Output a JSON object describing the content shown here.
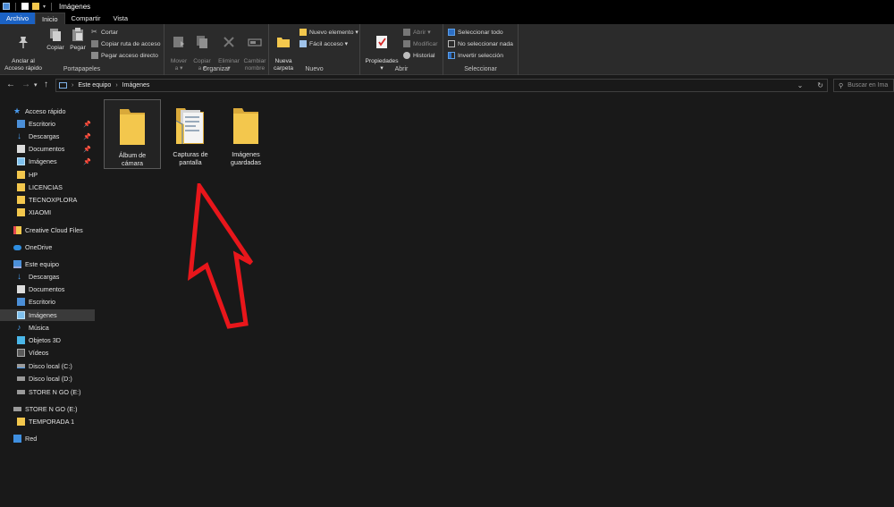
{
  "titlebar": {
    "title": "Imágenes"
  },
  "tabs": [
    {
      "label": "Archivo"
    },
    {
      "label": "Inicio"
    },
    {
      "label": "Compartir"
    },
    {
      "label": "Vista"
    }
  ],
  "ribbon": {
    "portapapeles": {
      "anclar": "Anclar al\nAcceso rápido",
      "copiar": "Copiar",
      "pegar": "Pegar",
      "cortar": "Cortar",
      "copiar_ruta": "Copiar ruta de acceso",
      "pegar_acceso": "Pegar acceso directo",
      "label": "Portapapeles"
    },
    "organizar": {
      "mover": "Mover\na ▾",
      "copiar_a": "Copiar\na ▾",
      "eliminar": "Eliminar\n▾",
      "cambiar_nombre": "Cambiar\nnombre",
      "label": "Organizar"
    },
    "nuevo": {
      "nueva_carpeta": "Nueva\ncarpeta",
      "nuevo_elemento": "Nuevo elemento ▾",
      "facil_acceso": "Fácil acceso ▾",
      "label": "Nuevo"
    },
    "abrir": {
      "propiedades": "Propiedades\n▾",
      "abrir": "Abrir ▾",
      "modificar": "Modificar",
      "historial": "Historial",
      "label": "Abrir"
    },
    "seleccionar": {
      "seleccionar_todo": "Seleccionar todo",
      "no_seleccionar": "No seleccionar nada",
      "invertir": "Invertir selección",
      "label": "Seleccionar"
    }
  },
  "address": {
    "crumb1": "Este equipo",
    "crumb2": "Imágenes",
    "search_placeholder": "Buscar en Ima"
  },
  "sidebar": {
    "items": [
      {
        "label": "Acceso rápido"
      },
      {
        "label": "Escritorio"
      },
      {
        "label": "Descargas"
      },
      {
        "label": "Documentos"
      },
      {
        "label": "Imágenes"
      },
      {
        "label": "HP"
      },
      {
        "label": "LICENCIAS"
      },
      {
        "label": "TECNOXPLORA"
      },
      {
        "label": "XIAOMI"
      },
      {
        "label": "Creative Cloud Files"
      },
      {
        "label": "OneDrive"
      },
      {
        "label": "Este equipo"
      },
      {
        "label": "Descargas"
      },
      {
        "label": "Documentos"
      },
      {
        "label": "Escritorio"
      },
      {
        "label": "Imágenes"
      },
      {
        "label": "Música"
      },
      {
        "label": "Objetos 3D"
      },
      {
        "label": "Vídeos"
      },
      {
        "label": "Disco local (C:)"
      },
      {
        "label": "Disco local (D:)"
      },
      {
        "label": "STORE N GO (E:)"
      },
      {
        "label": "STORE N GO (E:)"
      },
      {
        "label": "TEMPORADA 1"
      },
      {
        "label": "Red"
      }
    ]
  },
  "folders": [
    {
      "line1": "Álbum de",
      "line2": "cámara"
    },
    {
      "line1": "Capturas de",
      "line2": "pantalla"
    },
    {
      "line1": "Imágenes",
      "line2": "guardadas"
    }
  ],
  "colors": {
    "accent": "#1b62c4",
    "folder": "#f3c74d",
    "arrow": "#e8161b",
    "background": "#191919",
    "ribbon": "#2b2b2b"
  }
}
